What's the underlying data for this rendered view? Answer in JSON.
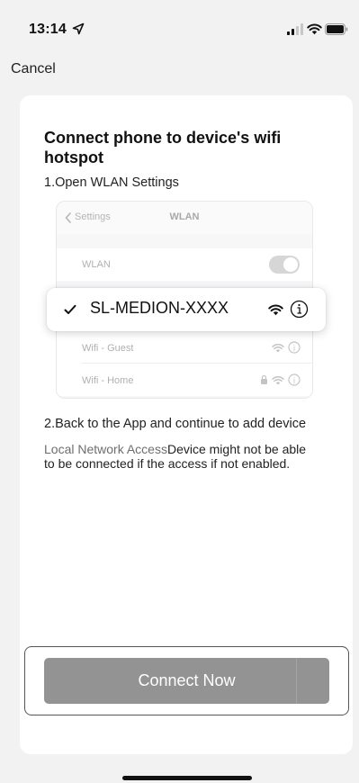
{
  "status_bar": {
    "time": "13:14",
    "icons": [
      "location-arrow-icon",
      "cellular-signal-icon",
      "wifi-icon",
      "battery-icon"
    ]
  },
  "nav": {
    "cancel_label": "Cancel"
  },
  "content": {
    "title": "Connect phone to device's wifi hotspot",
    "step1": "1.Open WLAN Settings",
    "illustration": {
      "back_label": "Settings",
      "header_title": "WLAN",
      "wlan_row_label": "WLAN",
      "selected_network": "SL-MEDION-XXXX",
      "networks": [
        "Wifi - Guest",
        "Wifi - Home"
      ]
    },
    "step2": "2.Back to the App and continue to add device",
    "note_highlight": "Local Network Access",
    "note_text": "Device might not be able to be connected if the access if not enabled."
  },
  "footer": {
    "connect_label": "Connect Now"
  },
  "colors": {
    "page_background": "#f2f2f2",
    "card_background": "#ffffff",
    "button_background": "#939393",
    "button_text": "#ffffff",
    "muted_text": "#6e6e6e"
  }
}
